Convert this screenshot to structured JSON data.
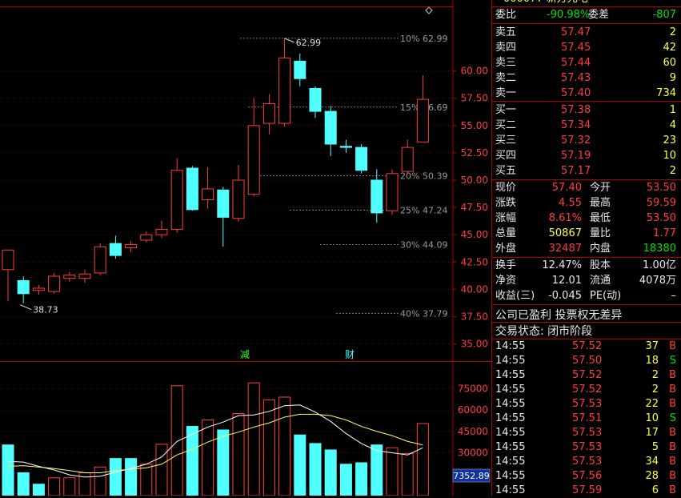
{
  "header": {
    "stock_code_partial": "000077 新方元电"
  },
  "price_axis": {
    "labels": [
      "60.00",
      "57.50",
      "55.00",
      "52.50",
      "50.00",
      "47.50",
      "45.00",
      "42.50",
      "40.00",
      "37.50",
      "35.00"
    ]
  },
  "fib_levels": [
    {
      "label": "10% 62.99"
    },
    {
      "label": "15% 56.69"
    },
    {
      "label": "20% 50.39"
    },
    {
      "label": "25% 47.24"
    },
    {
      "label": "30% 44.09"
    },
    {
      "label": "40% 37.79"
    }
  ],
  "annotations": {
    "high_marker": "62.99",
    "low_marker": "38.73",
    "event_1": "减",
    "event_2": "财"
  },
  "chart_data": {
    "type": "candlestick",
    "price_range": [
      33.5,
      66.5
    ],
    "candles": [
      {
        "o": 41.8,
        "h": 43.6,
        "l": 38.9,
        "c": 43.6
      },
      {
        "o": 40.8,
        "h": 41.2,
        "l": 38.73,
        "c": 39.6
      },
      {
        "o": 39.9,
        "h": 40.4,
        "l": 39.5,
        "c": 40.1
      },
      {
        "o": 39.8,
        "h": 41.5,
        "l": 39.6,
        "c": 41.2
      },
      {
        "o": 41.0,
        "h": 41.6,
        "l": 40.7,
        "c": 41.3
      },
      {
        "o": 41.0,
        "h": 41.8,
        "l": 40.6,
        "c": 41.4
      },
      {
        "o": 41.5,
        "h": 44.2,
        "l": 41.3,
        "c": 43.9
      },
      {
        "o": 44.2,
        "h": 44.9,
        "l": 42.8,
        "c": 43.1
      },
      {
        "o": 43.8,
        "h": 44.4,
        "l": 43.4,
        "c": 44.1
      },
      {
        "o": 44.5,
        "h": 45.3,
        "l": 44.3,
        "c": 45.0
      },
      {
        "o": 45.0,
        "h": 46.3,
        "l": 44.7,
        "c": 45.5
      },
      {
        "o": 45.5,
        "h": 52.0,
        "l": 45.2,
        "c": 50.9
      },
      {
        "o": 51.1,
        "h": 51.3,
        "l": 47.2,
        "c": 47.3
      },
      {
        "o": 48.2,
        "h": 51.2,
        "l": 47.4,
        "c": 49.2
      },
      {
        "o": 49.1,
        "h": 49.4,
        "l": 43.9,
        "c": 46.6
      },
      {
        "o": 46.5,
        "h": 51.4,
        "l": 46.2,
        "c": 50.0
      },
      {
        "o": 48.7,
        "h": 57.5,
        "l": 48.5,
        "c": 55.0
      },
      {
        "o": 55.2,
        "h": 57.9,
        "l": 54.2,
        "c": 57.0
      },
      {
        "o": 55.2,
        "h": 62.99,
        "l": 54.9,
        "c": 61.2
      },
      {
        "o": 60.9,
        "h": 61.6,
        "l": 58.6,
        "c": 59.3
      },
      {
        "o": 58.4,
        "h": 58.6,
        "l": 55.7,
        "c": 56.3
      },
      {
        "o": 56.3,
        "h": 56.8,
        "l": 52.2,
        "c": 53.3
      },
      {
        "o": 53.1,
        "h": 53.7,
        "l": 52.5,
        "c": 53.0
      },
      {
        "o": 53.0,
        "h": 53.3,
        "l": 50.6,
        "c": 50.9
      },
      {
        "o": 50.0,
        "h": 51.0,
        "l": 46.1,
        "c": 47.0
      },
      {
        "o": 47.2,
        "h": 51.0,
        "l": 46.8,
        "c": 50.6
      },
      {
        "o": 50.8,
        "h": 53.7,
        "l": 50.6,
        "c": 53.0
      },
      {
        "o": 53.5,
        "h": 59.59,
        "l": 53.5,
        "c": 57.4
      }
    ],
    "volume_axis": {
      "labels": [
        "75000",
        "60000",
        "45000",
        "30000"
      ],
      "range": [
        0,
        92000
      ]
    },
    "volumes": [
      {
        "v": 35500,
        "up": false
      },
      {
        "v": 16000,
        "up": false
      },
      {
        "v": 8000,
        "up": false
      },
      {
        "v": 12500,
        "up": true
      },
      {
        "v": 12500,
        "up": true
      },
      {
        "v": 16000,
        "up": true
      },
      {
        "v": 20000,
        "up": true
      },
      {
        "v": 26000,
        "up": false
      },
      {
        "v": 26000,
        "up": false
      },
      {
        "v": 22000,
        "up": true
      },
      {
        "v": 36000,
        "up": true
      },
      {
        "v": 77000,
        "up": true
      },
      {
        "v": 48500,
        "up": false
      },
      {
        "v": 53000,
        "up": true
      },
      {
        "v": 46000,
        "up": false
      },
      {
        "v": 57500,
        "up": true
      },
      {
        "v": 79000,
        "up": true
      },
      {
        "v": 67000,
        "up": true
      },
      {
        "v": 69000,
        "up": true
      },
      {
        "v": 42500,
        "up": false
      },
      {
        "v": 36500,
        "up": false
      },
      {
        "v": 32000,
        "up": false
      },
      {
        "v": 22000,
        "up": false
      },
      {
        "v": 23000,
        "up": false
      },
      {
        "v": 35500,
        "up": false
      },
      {
        "v": 33500,
        "up": true
      },
      {
        "v": 29500,
        "up": true
      },
      {
        "v": 50500,
        "up": true
      }
    ],
    "ma5": [
      24000,
      23500,
      20500,
      18000,
      14500,
      13000,
      13500,
      16500,
      19000,
      22000,
      27000,
      38000,
      43000,
      48000,
      51500,
      56000,
      56500,
      59000,
      63000,
      63500,
      58500,
      52000,
      43500,
      36500,
      31500,
      30000,
      28500,
      33500
    ],
    "ma10": [
      20500,
      21000,
      20000,
      19000,
      17500,
      16000,
      16000,
      17500,
      18500,
      19500,
      22000,
      28500,
      32500,
      37500,
      41500,
      44500,
      48000,
      51000,
      55000,
      57000,
      57000,
      56000,
      53000,
      48500,
      45000,
      42000,
      38000,
      35500
    ],
    "volume_readout": "7352.89"
  },
  "quote": {
    "weibi_label": "委比",
    "weibi_value": "-90.98%",
    "weicha_label": "委差",
    "weicha_value": "-807",
    "asks": [
      {
        "label": "卖五",
        "price": "57.47",
        "vol": "2"
      },
      {
        "label": "卖四",
        "price": "57.45",
        "vol": "42"
      },
      {
        "label": "卖三",
        "price": "57.44",
        "vol": "60"
      },
      {
        "label": "卖二",
        "price": "57.43",
        "vol": "9"
      },
      {
        "label": "卖一",
        "price": "57.40",
        "vol": "734"
      }
    ],
    "bids": [
      {
        "label": "买一",
        "price": "57.38",
        "vol": "1"
      },
      {
        "label": "买二",
        "price": "57.34",
        "vol": "4"
      },
      {
        "label": "买三",
        "price": "57.32",
        "vol": "23"
      },
      {
        "label": "买四",
        "price": "57.19",
        "vol": "10"
      },
      {
        "label": "买五",
        "price": "57.17",
        "vol": "2"
      }
    ],
    "stats": [
      {
        "l1": "现价",
        "v1": "57.40",
        "c1": "red",
        "l2": "今开",
        "v2": "53.50",
        "c2": "red"
      },
      {
        "l1": "涨跌",
        "v1": "4.55",
        "c1": "red",
        "l2": "最高",
        "v2": "59.59",
        "c2": "red"
      },
      {
        "l1": "涨幅",
        "v1": "8.61%",
        "c1": "red",
        "l2": "最低",
        "v2": "53.50",
        "c2": "red"
      },
      {
        "l1": "总量",
        "v1": "50867",
        "c1": "yellow",
        "l2": "量比",
        "v2": "1.77",
        "c2": "red"
      },
      {
        "l1": "外盘",
        "v1": "32487",
        "c1": "red",
        "l2": "内盘",
        "v2": "18380",
        "c2": "green"
      }
    ],
    "stats2": [
      {
        "l1": "换手",
        "v1": "12.47%",
        "l2": "股本",
        "v2": "1.00亿"
      },
      {
        "l1": "净资",
        "v1": "12.01",
        "l2": "流通",
        "v2": "4078万"
      },
      {
        "l1": "收益(三)",
        "v1": "-0.045",
        "l2": "PE(动)",
        "v2": "–"
      }
    ],
    "notice": "公司已盈利 投票权无差异",
    "trade_status": "交易状态: 闭市阶段"
  },
  "ticks": [
    {
      "time": "14:55",
      "price": "57.52",
      "vol": "37",
      "side": "B"
    },
    {
      "time": "14:55",
      "price": "57.50",
      "vol": "18",
      "side": "S"
    },
    {
      "time": "14:55",
      "price": "57.52",
      "vol": "2",
      "side": "B"
    },
    {
      "time": "14:55",
      "price": "57.52",
      "vol": "2",
      "side": "B"
    },
    {
      "time": "14:55",
      "price": "57.53",
      "vol": "22",
      "side": "B"
    },
    {
      "time": "14:55",
      "price": "57.51",
      "vol": "10",
      "side": "S"
    },
    {
      "time": "14:55",
      "price": "57.53",
      "vol": "17",
      "side": "B"
    },
    {
      "time": "14:55",
      "price": "57.53",
      "vol": "5",
      "side": "B"
    },
    {
      "time": "14:55",
      "price": "57.53",
      "vol": "34",
      "side": "B"
    },
    {
      "time": "14:55",
      "price": "57.56",
      "vol": "28",
      "side": "B"
    },
    {
      "time": "14:55",
      "price": "57.59",
      "vol": "6",
      "side": "B"
    }
  ],
  "colors": {
    "up": "#ff3c3c",
    "down": "#50ffff",
    "grid": "#b00000",
    "ma5": "#ffffff",
    "ma10": "#ffff60"
  }
}
